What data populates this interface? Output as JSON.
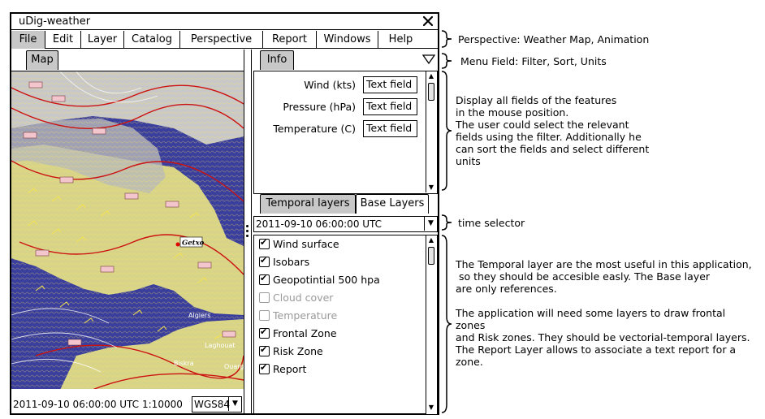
{
  "window": {
    "title": "uDig-weather"
  },
  "menu": {
    "items": [
      "File",
      "Edit",
      "Layer",
      "Catalog",
      "Perspective",
      "Report",
      "Windows",
      "Help"
    ],
    "active": "File"
  },
  "map": {
    "tab_label": "Map",
    "status_time": "2011-09-10 06:00:00 UTC",
    "scale": "1:10000",
    "crs": "WGS84",
    "labels": {
      "getxo": "Getxo",
      "algiers": "Algiers",
      "laghouat": "Laghouat",
      "biskra": "Biskra",
      "ouargla": "Ouarg"
    },
    "colors": {
      "sea": "#3a3f9e",
      "land": "#d7d48a",
      "cloud": "#c8c8c8",
      "front": "#cc1111"
    }
  },
  "info": {
    "tab_label": "Info",
    "fields": [
      {
        "label": "Wind (kts)",
        "value": "Text field"
      },
      {
        "label": "Pressure (hPa)",
        "value": "Text field"
      },
      {
        "label": "Temperature (C)",
        "value": "Text field"
      }
    ]
  },
  "layer_tabs": {
    "temporal": "Temporal layers",
    "base": "Base Layers"
  },
  "time_selector": {
    "value": "2011-09-10 06:00:00 UTC"
  },
  "layers": [
    {
      "name": "Wind surface",
      "checked": true
    },
    {
      "name": "Isobars",
      "checked": true
    },
    {
      "name": "Geopotintial 500 hpa",
      "checked": true
    },
    {
      "name": "Cloud cover",
      "checked": false
    },
    {
      "name": "Temperature",
      "checked": false
    },
    {
      "name": "Frontal Zone",
      "checked": true
    },
    {
      "name": "Risk Zone",
      "checked": true
    },
    {
      "name": "Report",
      "checked": true
    }
  ],
  "annotations": {
    "perspective": "Perspective: Weather Map, Animation",
    "menu_field": "Menu Field: Filter, Sort, Units",
    "info": "Display all fields of the features\nin the mouse position.\nThe user could select the relevant\nfields using the filter. Additionally he\ncan sort the fields and select different\nunits",
    "time_selector": "time selector",
    "layers": "The Temporal layer are the most useful in this application,\n so they should be accesible easly. The Base layer\nare only references.\n\nThe application will need some layers to draw frontal\nzones\nand Risk zones. They should be vectorial-temporal layers.\nThe Report Layer allows to associate a text report for a\nzone."
  }
}
